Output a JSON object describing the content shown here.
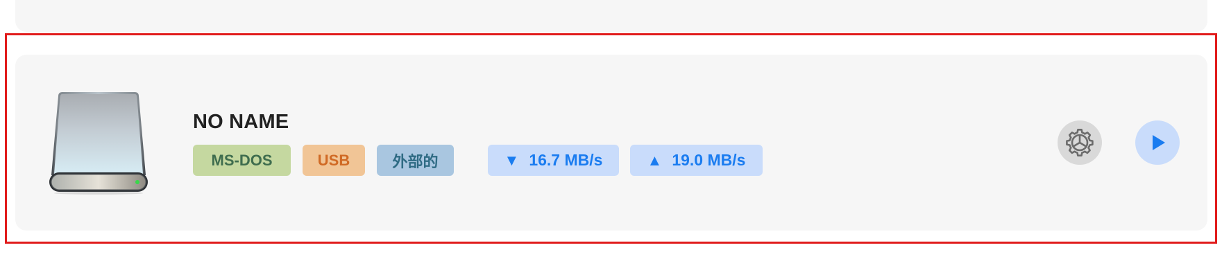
{
  "device": {
    "name": "NO NAME",
    "icon": "external-drive-icon",
    "tags": [
      {
        "label": "MS-DOS",
        "bg": "#c5d8a0",
        "fg": "#3f6d4e"
      },
      {
        "label": "USB",
        "bg": "#f1c596",
        "fg": "#d06a25"
      },
      {
        "label": "外部的",
        "bg": "#a9c6e0",
        "fg": "#2f6b84"
      }
    ],
    "speeds": {
      "read": {
        "arrow": "▼",
        "value": "16.7 MB/s"
      },
      "write": {
        "arrow": "▲",
        "value": "19.0 MB/s"
      },
      "bg": "#c9dcfb",
      "fg": "#1a7cf0"
    },
    "actions": {
      "settings_icon": "gear-icon",
      "play_icon": "play-icon"
    }
  },
  "colors": {
    "card_bg": "#f6f6f6",
    "highlight": "#e11b1b",
    "accent": "#1a7cf0",
    "gear_bg": "#d9d9d9",
    "play_bg": "#c9dcfb"
  }
}
